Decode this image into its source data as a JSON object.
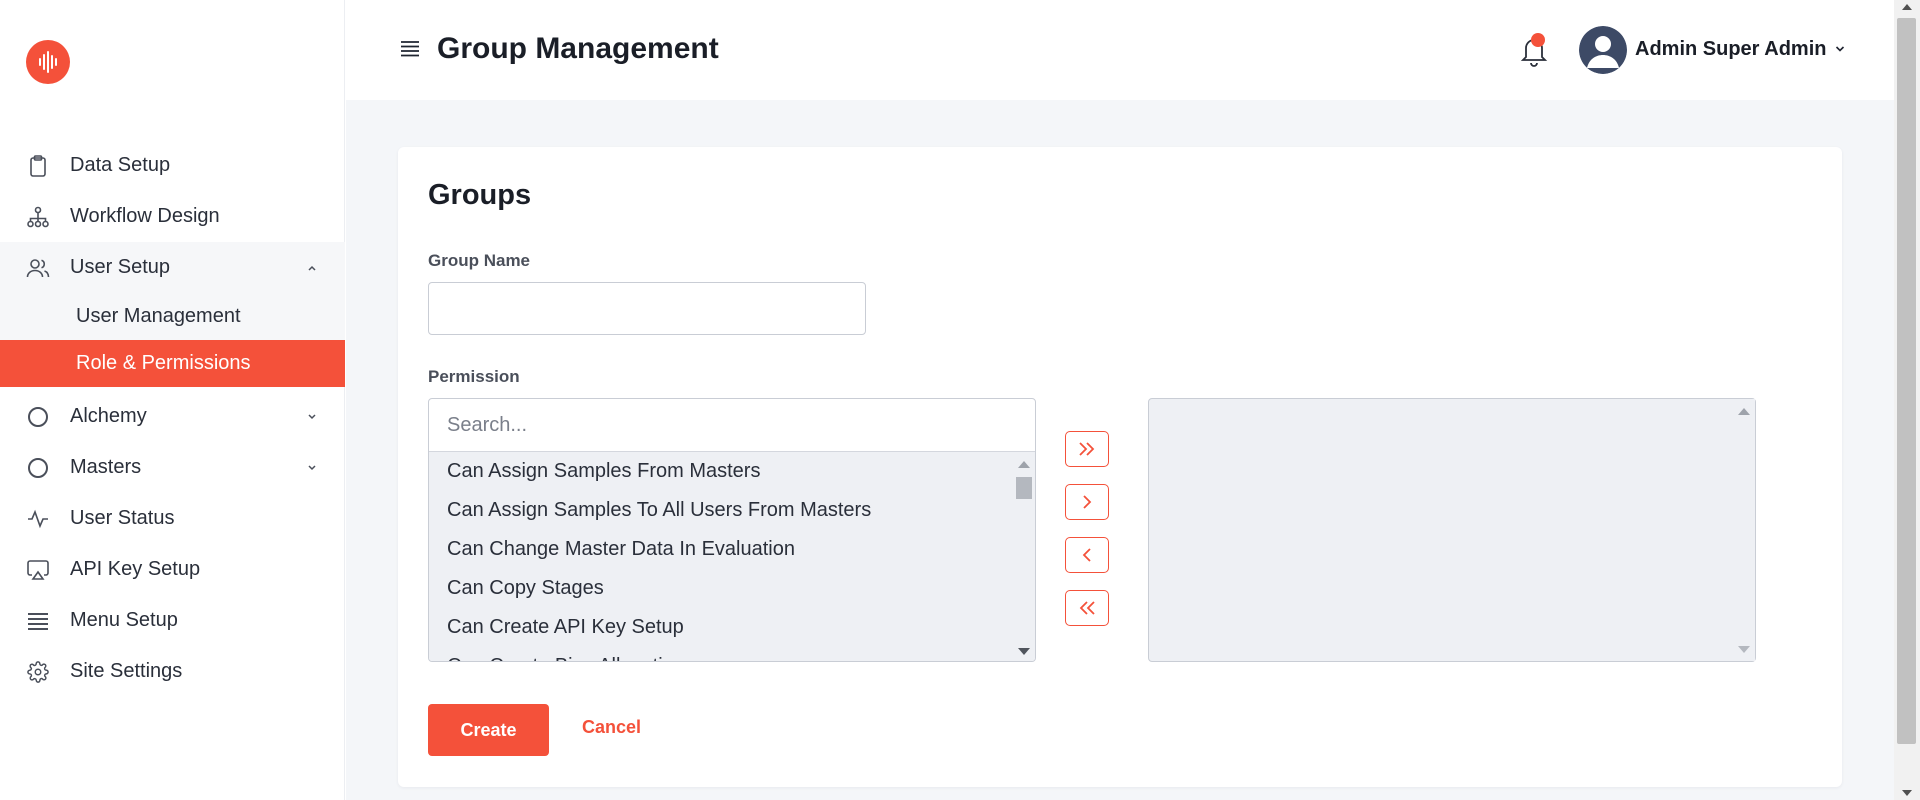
{
  "app": {
    "logo_icon": "soundwave-logo",
    "accent_color": "#f4513a"
  },
  "sidebar": {
    "items": [
      {
        "label": "Data Setup",
        "icon": "clipboard-icon"
      },
      {
        "label": "Workflow Design",
        "icon": "hierarchy-icon"
      },
      {
        "label": "User Setup",
        "icon": "users-icon",
        "expanded": true,
        "children": [
          {
            "label": "User Management"
          },
          {
            "label": "Role & Permissions",
            "active": true
          }
        ]
      },
      {
        "label": "Alchemy",
        "icon": "circle-icon"
      },
      {
        "label": "Masters",
        "icon": "circle-icon"
      },
      {
        "label": "User Status",
        "icon": "activity-icon"
      },
      {
        "label": "API Key Setup",
        "icon": "airplay-icon"
      },
      {
        "label": "Menu Setup",
        "icon": "list-icon"
      },
      {
        "label": "Site Settings",
        "icon": "gear-icon"
      }
    ]
  },
  "header": {
    "title": "Group Management",
    "user_name": "Admin Super Admin",
    "notification_badge": true
  },
  "form": {
    "card_title": "Groups",
    "group_name_label": "Group Name",
    "group_name_value": "",
    "permission_label": "Permission",
    "search_placeholder": "Search...",
    "available_permissions": [
      "Can Assign Samples From Masters",
      "Can Assign Samples To All Users From Masters",
      "Can Change Master Data In Evaluation",
      "Can Copy Stages",
      "Can Create API Key Setup",
      "Can Create Bias Allocation"
    ],
    "selected_permissions": [],
    "move_buttons": [
      "move-all-right",
      "move-right",
      "move-left",
      "move-all-left"
    ],
    "create_label": "Create",
    "cancel_label": "Cancel"
  }
}
